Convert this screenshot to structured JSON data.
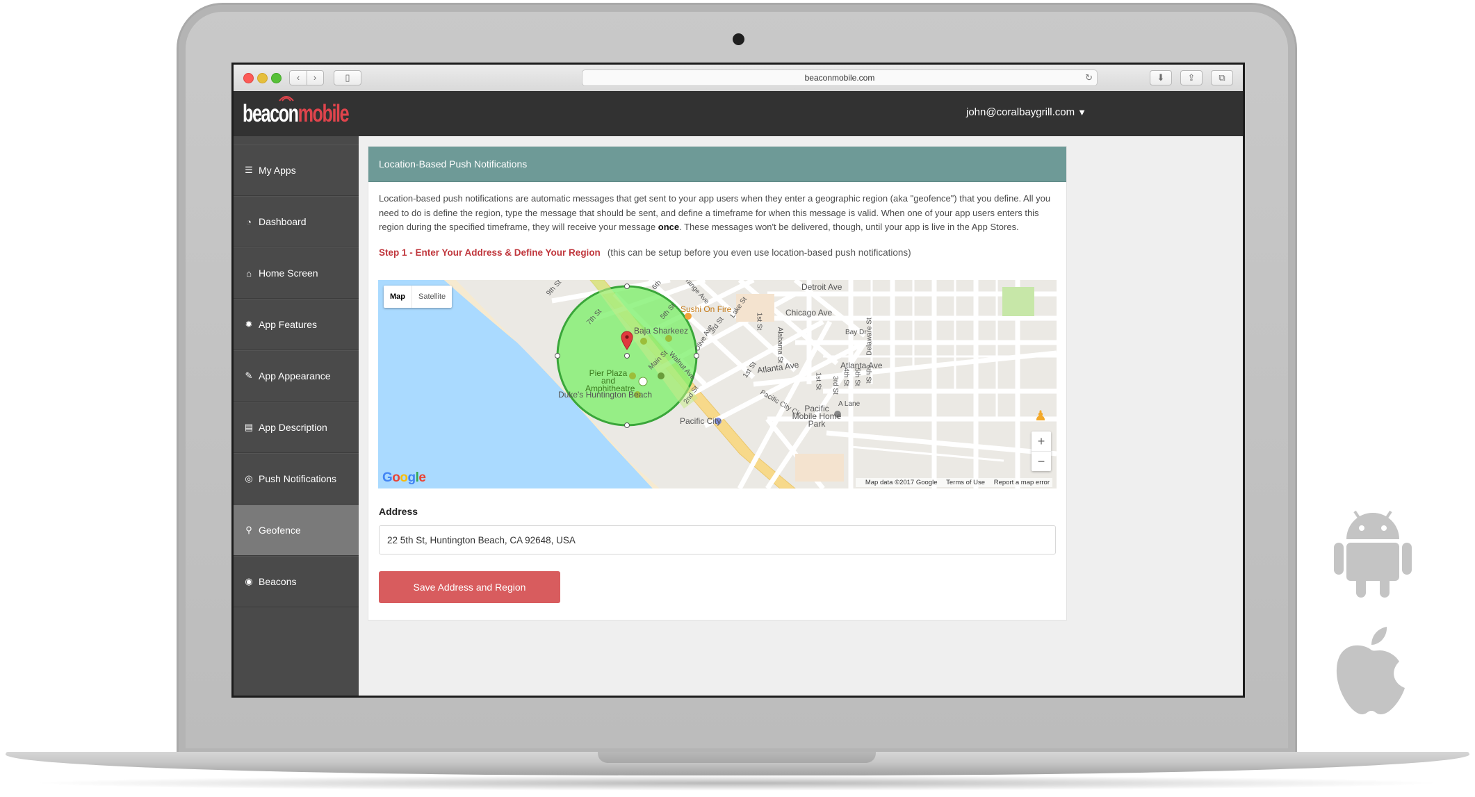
{
  "browser": {
    "url": "beaconmobile.com"
  },
  "header": {
    "logo_part1": "beacon",
    "logo_part2": "mobile",
    "user_email": "john@coralbaygrill.com",
    "caret": "▼"
  },
  "sidebar": {
    "items": [
      {
        "label": "My Apps",
        "icon": "list-icon"
      },
      {
        "label": "Dashboard",
        "icon": "dashboard-icon"
      },
      {
        "label": "Home Screen",
        "icon": "home-icon"
      },
      {
        "label": "App Features",
        "icon": "gear-icon"
      },
      {
        "label": "App Appearance",
        "icon": "paintbrush-icon"
      },
      {
        "label": "App Description",
        "icon": "document-icon"
      },
      {
        "label": "Push Notifications",
        "icon": "chat-icon"
      },
      {
        "label": "Geofence",
        "icon": "map-marker-icon",
        "active": true
      },
      {
        "label": "Beacons",
        "icon": "beacon-icon"
      }
    ]
  },
  "panel": {
    "title": "Location-Based Push Notifications",
    "intro_1": "Location-based push notifications are automatic messages that get sent to your app users when they enter a geographic region (aka \"geofence\") that you define. All you need to do is define the region, type the message that should be sent, and define a timeframe for when this message is valid. When one of your app users enters this region during the specified timeframe, they will receive your message ",
    "intro_bold": "once",
    "intro_2": ". These messages won't be delivered, though, until your app is live in the App Stores.",
    "step_title": "Step 1 - Enter Your Address & Define Your Region",
    "step_note": "(this can be setup before you even use location-based push notifications)"
  },
  "map": {
    "type_map": "Map",
    "type_satellite": "Satellite",
    "zoom_in": "+",
    "zoom_out": "−",
    "google": "Google",
    "attribution": "Map data ©2017 Google",
    "terms": "Terms of Use",
    "report": "Report a map error",
    "labels": {
      "detroit": "Detroit Ave",
      "chicago": "Chicago Ave",
      "atlanta_right": "Atlanta Ave",
      "atlanta_mid": "Atlanta Ave",
      "sushi": "Sushi On Fire",
      "baja": "Baja Sharkeez",
      "pier": "Pier Plaza and Amphitheatre",
      "dukes": "Duke's Huntington Beach",
      "pacific_city": "Pacific City",
      "pacific_mobile": "Pacific Mobile Home Park",
      "bay_dr": "Bay Dr",
      "alabama": "Alabama St",
      "delaware": "Delaware St",
      "a_lane": "A Lane",
      "pacific_city_cir": "Pacific City Cir",
      "main_st": "Main St",
      "walnut": "Walnut Ave",
      "olive": "Olive Ave",
      "orange": "Orange Ave",
      "lake": "Lake St",
      "s9th": "9th St",
      "s7th": "7th St",
      "s6th": "6th",
      "s5th": "5th St",
      "s3rd": "3rd St",
      "s2nd": "2nd St",
      "s1st": "1st St",
      "s1st_b": "1st St",
      "s1st_c": "1st St",
      "s3rd_b": "3rd St",
      "s4th": "4th St",
      "s5th_b": "5th St",
      "s6th_b": "6th St"
    },
    "colors": {
      "water": "#aadaff",
      "land": "#ebe9e4",
      "geofence_fill": "#7ef06b",
      "geofence_stroke": "#3aa63a",
      "pin": "#e0393e"
    }
  },
  "address": {
    "label": "Address",
    "value": "22 5th St, Huntington Beach, CA 92648, USA"
  },
  "save_button": "Save Address and Region",
  "platform_icons": [
    "android-icon",
    "apple-icon"
  ]
}
